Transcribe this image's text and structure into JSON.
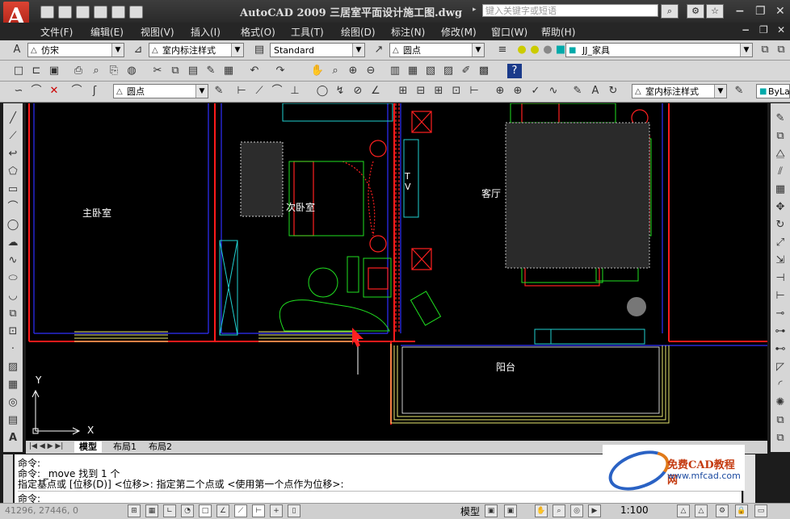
{
  "app": {
    "title": "AutoCAD 2009 三居室平面设计施工图.dwg",
    "logo_letter": "A",
    "search_placeholder": "键入关键字或短语"
  },
  "menu": [
    "文件(F)",
    "编辑(E)",
    "视图(V)",
    "插入(I)",
    "格式(O)",
    "工具(T)",
    "绘图(D)",
    "标注(N)",
    "修改(M)",
    "窗口(W)",
    "帮助(H)"
  ],
  "toolbar_row1": {
    "font_combo": "仿宋",
    "dim_style_combo": "室内标注样式",
    "text_style_combo": "Standard",
    "point_combo": "圆点",
    "layer_combo": "JJ_家具"
  },
  "toolbar_row3": {
    "point_combo": "圆点",
    "dim_style_combo": "室内标注样式",
    "bylayer_combo": "ByLa"
  },
  "drawing": {
    "rooms": {
      "master_bedroom": "主卧室",
      "second_bedroom": "次卧室",
      "living_room": "客厅",
      "balcony": "阳台",
      "tv": "T V"
    },
    "ucs_x": "X",
    "ucs_y": "Y"
  },
  "tabs": [
    "模型",
    "布局1",
    "布局2"
  ],
  "command": {
    "line1": "命令:",
    "line2": "命令:  _move 找到 1 个",
    "line3": "指定基点或 [位移(D)] <位移>:  指定第二个点或 <使用第一个点作为位移>:",
    "line4": "命令:"
  },
  "status": {
    "coords": "41296, 27446, 0",
    "model_label": "模型",
    "scale": "1:100"
  },
  "watermark": {
    "site_cn": "免费CAD教程网",
    "url": "www.mfcad.com"
  },
  "colors": {
    "wall": "#ff0000",
    "blue_line": "#3a3aff",
    "furniture_red": "#ff2020",
    "furniture_green": "#20e020",
    "cyan": "#20d0d0",
    "yellow": "#e8e870"
  }
}
